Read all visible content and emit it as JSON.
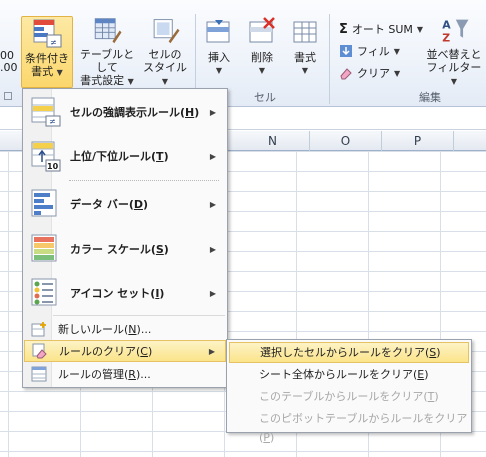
{
  "ribbon": {
    "conditional_format": {
      "line1": "条件付き",
      "line2": "書式"
    },
    "format_as_table": {
      "line1": "テーブルとして",
      "line2": "書式設定"
    },
    "cell_styles": {
      "line1": "セルの",
      "line2": "スタイル"
    },
    "insert": "挿入",
    "delete": "削除",
    "format": "書式",
    "cells_group": "セル",
    "autosum": "オート SUM",
    "fill": "フィル",
    "clear": "クリア",
    "sort_filter": {
      "line1": "並べ替えと",
      "line2": "フィルター"
    },
    "editing_group": "編集",
    "left_partial": {
      "line1": "00",
      "line2": ".00"
    }
  },
  "columns": [
    "N",
    "O",
    "P"
  ],
  "menu": {
    "items": [
      {
        "label": "セルの強調表示ルール(",
        "key": "H",
        "tail": ")",
        "icon": "highlight-rules-icon"
      },
      {
        "label": "上位/下位ルール(",
        "key": "T",
        "tail": ")",
        "icon": "top-bottom-rules-icon"
      },
      {
        "label": "データ バー(",
        "key": "D",
        "tail": ")",
        "icon": "data-bars-icon"
      },
      {
        "label": "カラー スケール(",
        "key": "S",
        "tail": ")",
        "icon": "color-scales-icon"
      },
      {
        "label": "アイコン セット(",
        "key": "I",
        "tail": ")",
        "icon": "icon-sets-icon"
      }
    ],
    "new_rule": {
      "label": "新しいルール(",
      "key": "N",
      "tail": ")..."
    },
    "clear_rules": {
      "label": "ルールのクリア(",
      "key": "C",
      "tail": ")"
    },
    "manage_rules": {
      "label": "ルールの管理(",
      "key": "R",
      "tail": ")..."
    }
  },
  "submenu": {
    "items": [
      {
        "label": "選択したセルからルールをクリア(",
        "key": "S",
        "tail": ")"
      },
      {
        "label": "シート全体からルールをクリア(",
        "key": "E",
        "tail": ")"
      },
      {
        "label": "このテーブルからルールをクリア(",
        "key": "T",
        "tail": ")"
      },
      {
        "label": "このピボットテーブルからルールをクリア(",
        "key": "P",
        "tail": ")"
      }
    ]
  },
  "colors": {
    "highlight": "#fbe48a",
    "highlight_border": "#e5c365",
    "accent": "#3a6fb7"
  }
}
